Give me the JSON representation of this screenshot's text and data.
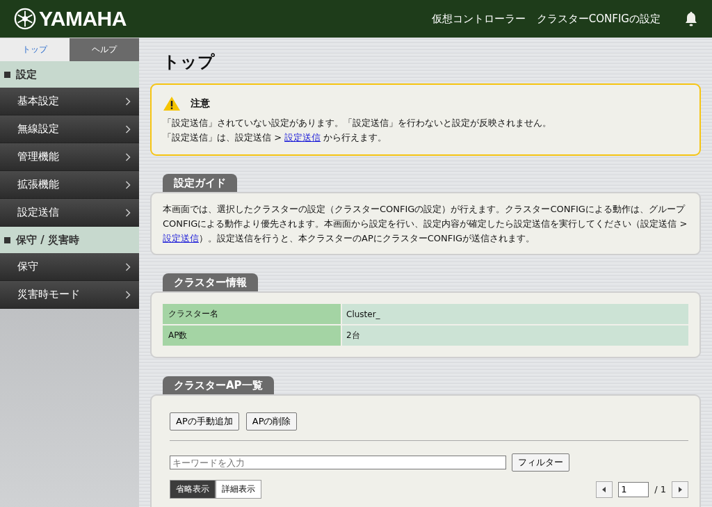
{
  "header": {
    "logo": "YAMAHA",
    "breadcrumb": [
      "仮想コントローラー",
      "クラスターCONFIGの設定"
    ]
  },
  "sidebar": {
    "tabs": [
      {
        "label": "トップ",
        "selected": true
      },
      {
        "label": "ヘルプ",
        "selected": false
      }
    ],
    "sections": [
      {
        "title": "設定",
        "items": [
          "基本設定",
          "無線設定",
          "管理機能",
          "拡張機能",
          "設定送信"
        ]
      },
      {
        "title": "保守 / 災害時",
        "items": [
          "保守",
          "災害時モード"
        ]
      }
    ]
  },
  "page_title": "トップ",
  "notice": {
    "title": "注意",
    "line1": "「設定送信」されていない設定があります。「設定送信」を行わないと設定が反映されません。",
    "line2_before": "「設定送信」は、設定送信 > ",
    "line2_link": "設定送信",
    "line2_after": " から行えます。"
  },
  "guide": {
    "title": "設定ガイド",
    "before": "本画面では、選択したクラスターの設定（クラスターCONFIGの設定）が行えます。クラスターCONFIGによる動作は、グループCONFIGによる動作より優先されます。本画面から設定を行い、設定内容が確定したら設定送信を実行してください（設定送信 > ",
    "link": "設定送信",
    "after": "）。設定送信を行うと、本クラスターのAPにクラスターCONFIGが送信されます。"
  },
  "cluster_info": {
    "title": "クラスター情報",
    "rows": [
      {
        "label": "クラスター名",
        "value": "Cluster_"
      },
      {
        "label": "AP数",
        "value": "2台"
      }
    ]
  },
  "ap_list": {
    "title": "クラスターAP一覧",
    "buttons": [
      "APの手動追加",
      "APの削除"
    ],
    "filter": {
      "placeholder": "キーワードを入力",
      "button": "フィルター"
    },
    "view_tabs": [
      {
        "label": "省略表示",
        "selected": true
      },
      {
        "label": "詳細表示",
        "selected": false
      }
    ],
    "pagination": {
      "page": "1",
      "total": "/ 1"
    }
  }
}
